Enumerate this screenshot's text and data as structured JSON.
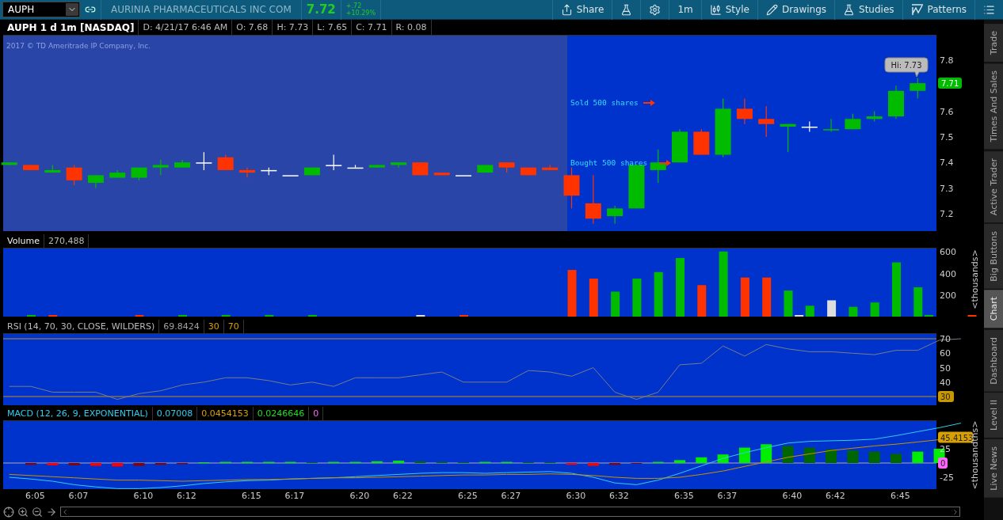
{
  "symbol_field": {
    "value": "AUPH"
  },
  "company": "AURINIA PHARMACEUTICALS INC COM",
  "last_price": "7.72",
  "change": {
    "net": "+.72",
    "percent": "+10.29%"
  },
  "toolbar": [
    {
      "kind": "share",
      "label": "Share"
    },
    {
      "kind": "flask"
    },
    {
      "kind": "gear"
    },
    {
      "kind": "text",
      "label": "1m"
    },
    {
      "kind": "style",
      "label": "Style"
    },
    {
      "kind": "drawings",
      "label": "Drawings"
    },
    {
      "kind": "studies",
      "label": "Studies"
    },
    {
      "kind": "patterns",
      "label": "Patterns"
    },
    {
      "kind": "menu"
    }
  ],
  "chart_header": {
    "title": "AUPH 1 d 1m [NASDAQ]",
    "fields": [
      "D: 4/21/17 6:46 AM",
      "O: 7.68",
      "H: 7.73",
      "L: 7.65",
      "C: 7.71",
      "R: 0.08"
    ]
  },
  "copyright": "2017 © TD Ameritrade IP Company, Inc.",
  "annotations": [
    {
      "text": "Sold 500 shares"
    },
    {
      "text": "Bought 500 shares"
    }
  ],
  "high_callout": "Hi: 7.73",
  "price_axis": {
    "ticks": [
      "7.8",
      "7.6",
      "7.5",
      "7.4",
      "7.3",
      "7.2"
    ],
    "last_tag": "7.71"
  },
  "volume": {
    "label": "Volume",
    "value": "270,488",
    "ticks": [
      "600",
      "400",
      "200"
    ],
    "unit": "<thousands>"
  },
  "rsi": {
    "label": "RSI (14, 70, 30, CLOSE, WILDERS)",
    "values": [
      {
        "text": "69.8424",
        "color": "#a0a0a0"
      },
      {
        "text": "30",
        "color": "#d8a000"
      },
      {
        "text": "70",
        "color": "#d8a000"
      }
    ],
    "ticks": [
      "70",
      "60",
      "50",
      "40"
    ],
    "tag": "30"
  },
  "macd": {
    "label": "MACD (12, 26, 9, EXPONENTIAL)",
    "values": [
      {
        "text": "0.07008",
        "color": "#33ccee"
      },
      {
        "text": "0.0454153",
        "color": "#d8a000"
      },
      {
        "text": "0.0246646",
        "color": "#22dd22"
      },
      {
        "text": "0",
        "color": "#ff66ff"
      }
    ],
    "tags": [
      {
        "text": "45.4153",
        "color": "#d8a000"
      },
      {
        "text": "0",
        "color": "#ff66ff"
      }
    ],
    "ticks": [
      "25",
      "-25"
    ],
    "unit": "<thousandths>"
  },
  "time_axis": [
    "6:05",
    "6:07",
    "6:10",
    "6:12",
    "6:15",
    "6:17",
    "6:20",
    "6:22",
    "6:25",
    "6:27",
    "6:30",
    "6:32",
    "6:35",
    "6:37",
    "6:40",
    "6:42",
    "6:45"
  ],
  "side_tabs": [
    {
      "label": "Trade",
      "selected": false
    },
    {
      "label": "Times And Sales",
      "selected": false
    },
    {
      "label": "Active Trader",
      "selected": false
    },
    {
      "label": "Big Buttons",
      "selected": false
    },
    {
      "label": "Chart",
      "selected": true
    },
    {
      "label": "Dashboard",
      "selected": false
    },
    {
      "label": "Level II",
      "selected": false
    },
    {
      "label": "Live News",
      "selected": false
    }
  ]
}
